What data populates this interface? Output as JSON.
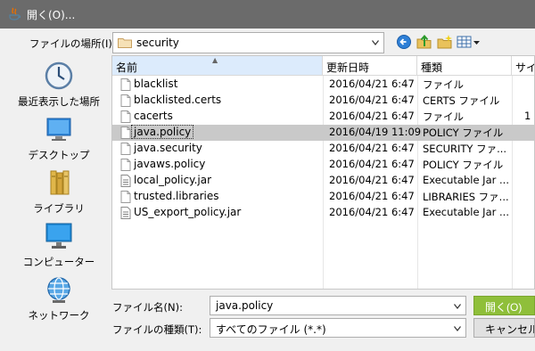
{
  "window": {
    "title": "開く(O)...",
    "icon": "java-icon"
  },
  "toolbar": {
    "lookin_label": "ファイルの場所(I):",
    "lookin_value": "security",
    "icons": [
      "back-icon",
      "up-folder-icon",
      "new-folder-icon",
      "view-menu-icon"
    ]
  },
  "places": [
    {
      "label": "最近表示した場所",
      "icon": "recent-clock-icon"
    },
    {
      "label": "デスクトップ",
      "icon": "desktop-icon"
    },
    {
      "label": "ライブラリ",
      "icon": "library-icon"
    },
    {
      "label": "コンピューター",
      "icon": "computer-icon"
    },
    {
      "label": "ネットワーク",
      "icon": "network-icon"
    }
  ],
  "columns": {
    "name": "名前",
    "modified": "更新日時",
    "type": "種類",
    "size": "サイ"
  },
  "files": [
    {
      "name": "blacklist",
      "modified": "2016/04/21 6:47",
      "type": "ファイル",
      "size": "",
      "icon": "file-icon"
    },
    {
      "name": "blacklisted.certs",
      "modified": "2016/04/21 6:47",
      "type": "CERTS ファイル",
      "size": "",
      "icon": "file-icon"
    },
    {
      "name": "cacerts",
      "modified": "2016/04/21 6:47",
      "type": "ファイル",
      "size": "1",
      "icon": "file-icon"
    },
    {
      "name": "java.policy",
      "modified": "2016/04/19 11:09",
      "type": "POLICY ファイル",
      "size": "",
      "icon": "file-icon"
    },
    {
      "name": "java.security",
      "modified": "2016/04/21 6:47",
      "type": "SECURITY ファ...",
      "size": "",
      "icon": "file-icon"
    },
    {
      "name": "javaws.policy",
      "modified": "2016/04/21 6:47",
      "type": "POLICY ファイル",
      "size": "",
      "icon": "file-icon"
    },
    {
      "name": "local_policy.jar",
      "modified": "2016/04/21 6:47",
      "type": "Executable Jar ...",
      "size": "",
      "icon": "jar-icon"
    },
    {
      "name": "trusted.libraries",
      "modified": "2016/04/21 6:47",
      "type": "LIBRARIES ファ...",
      "size": "",
      "icon": "file-icon"
    },
    {
      "name": "US_export_policy.jar",
      "modified": "2016/04/21 6:47",
      "type": "Executable Jar ...",
      "size": "",
      "icon": "jar-icon"
    }
  ],
  "selected_file": "java.policy",
  "filename": {
    "label": "ファイル名(N):",
    "value": "java.policy"
  },
  "filetype": {
    "label": "ファイルの種類(T):",
    "value": "すべてのファイル (*.*)"
  },
  "buttons": {
    "open": "開く(O)",
    "cancel": "キャンセル"
  },
  "colors": {
    "titlebar": "#6b6b6b",
    "accent": "#8fbf3a",
    "selection": "#c9c9c9",
    "sorted_header": "#dcebfc"
  }
}
